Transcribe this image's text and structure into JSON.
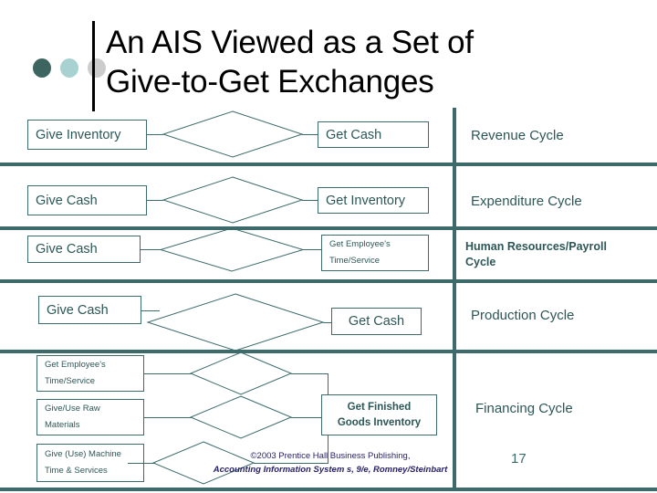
{
  "slide": {
    "title_lines": [
      "An AIS Viewed as a Set of",
      "Give-to-Get Exchanges"
    ],
    "page_number": "17",
    "colors": {
      "accent_dark_teal": "#3d6b6b",
      "text_teal": "#2d5757",
      "dot_dark": "#3c6560",
      "dot_light": "#a8d2d2",
      "dot_gray": "#cccccc",
      "footer_navy": "#241f67",
      "title_black": "#000000"
    },
    "decor_dots": [
      "dot-dark-teal",
      "dot-light-teal",
      "dot-light-gray"
    ]
  },
  "rows": [
    {
      "give": "Give Inventory",
      "get": "Get Cash",
      "cycle": "Revenue Cycle"
    },
    {
      "give": "Give Cash",
      "get": "Get Inventory",
      "cycle": "Expenditure Cycle"
    },
    {
      "give": "Give Cash",
      "get_line1": "Get Employee's",
      "get_line2": "Time/Service",
      "cycle": "Human Resources/Payroll Cycle",
      "cycle_line1": "Human Resources/Payroll",
      "cycle_line2": "Cycle"
    },
    {
      "give": "Give Cash",
      "get": "Get Cash",
      "cycle": "Production Cycle"
    },
    {
      "gives": [
        {
          "line1": "Get Employee's",
          "line2": "Time/Service"
        },
        {
          "line1": "Give/Use Raw",
          "line2": "Materials"
        },
        {
          "line1": "Give (Use) Machine",
          "line2": "Time & Services"
        }
      ],
      "get_line1": "Get Finished",
      "get_line2": "Goods Inventory",
      "cycle": "Financing Cycle"
    }
  ],
  "footer": {
    "line1": "©2003 Prentice Hall Business Publishing,",
    "line2": "Accounting Information System s, 9/e, Romney/Steinbart"
  }
}
